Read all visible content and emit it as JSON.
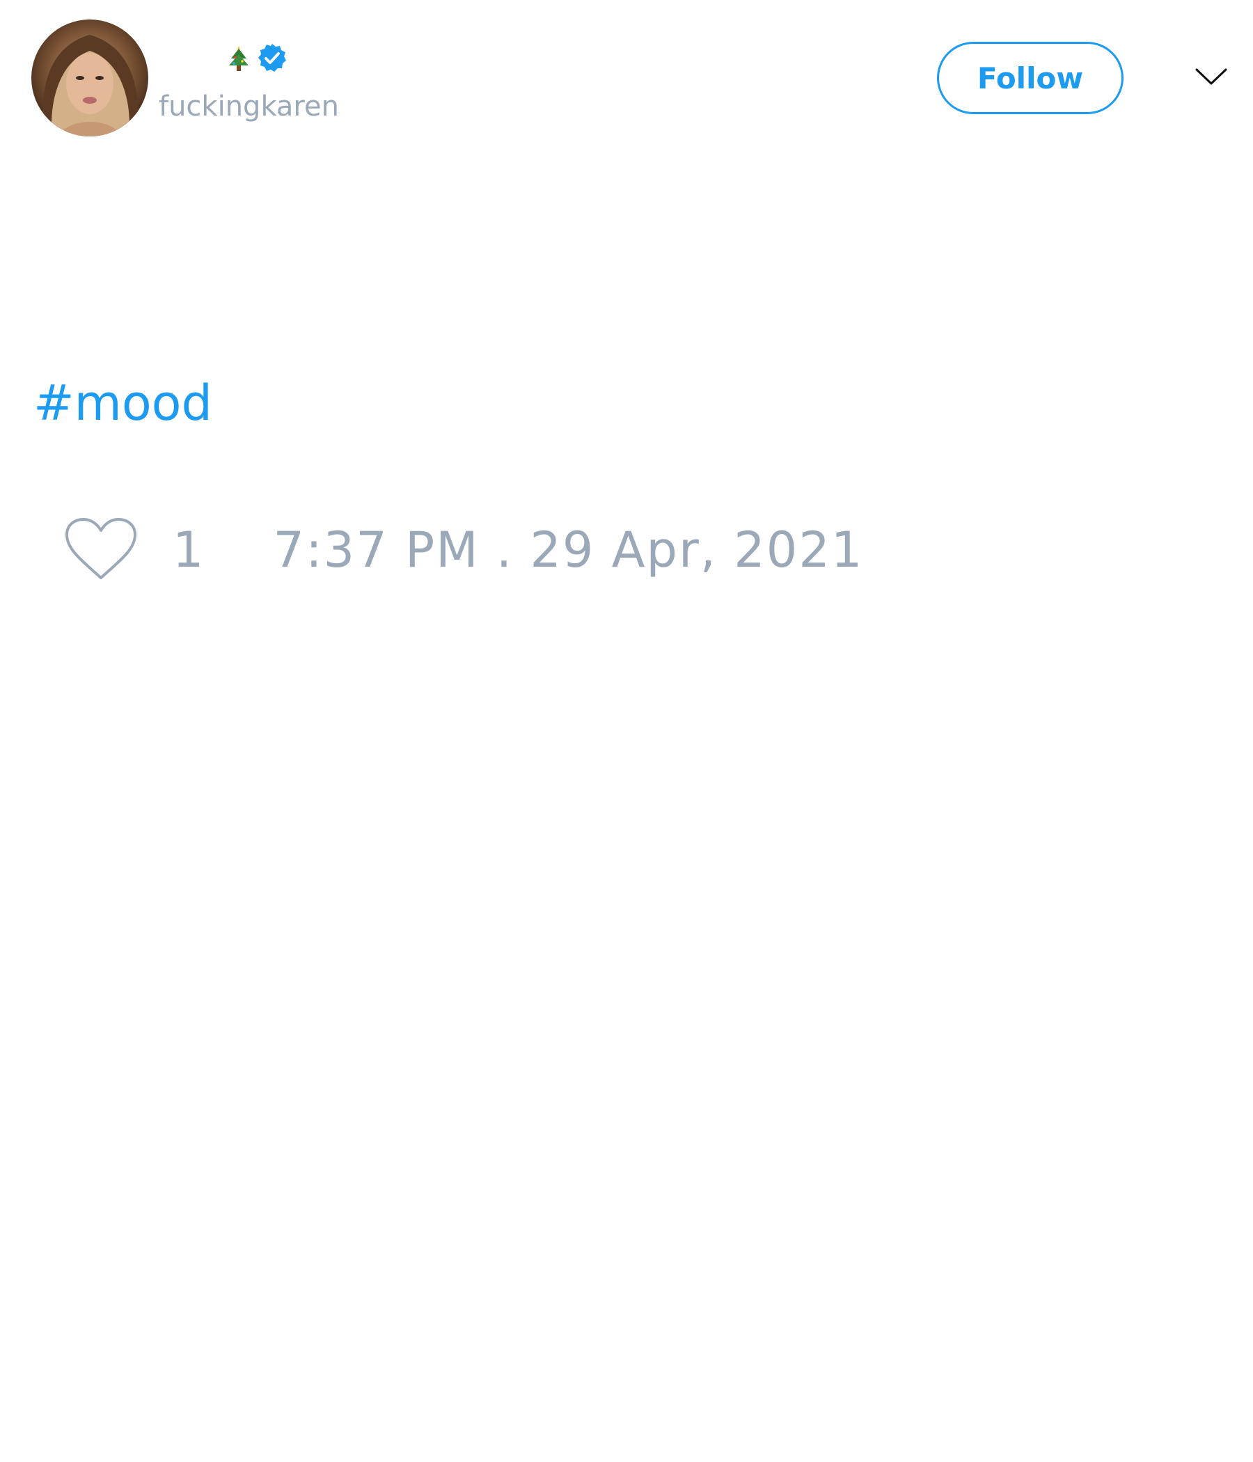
{
  "user": {
    "display_name_emoji": "🎄",
    "verified": true,
    "handle": "fuckingkaren",
    "avatar_description": "profile-photo"
  },
  "header": {
    "follow_label": "Follow",
    "menu_icon": "chevron-down-icon"
  },
  "tweet": {
    "text": "#mood",
    "like_count": "1",
    "timestamp": "7:37 PM . 29 Apr, 2021"
  },
  "colors": {
    "accent": "#1d9bf0",
    "muted_text": "#9aa8b8"
  }
}
